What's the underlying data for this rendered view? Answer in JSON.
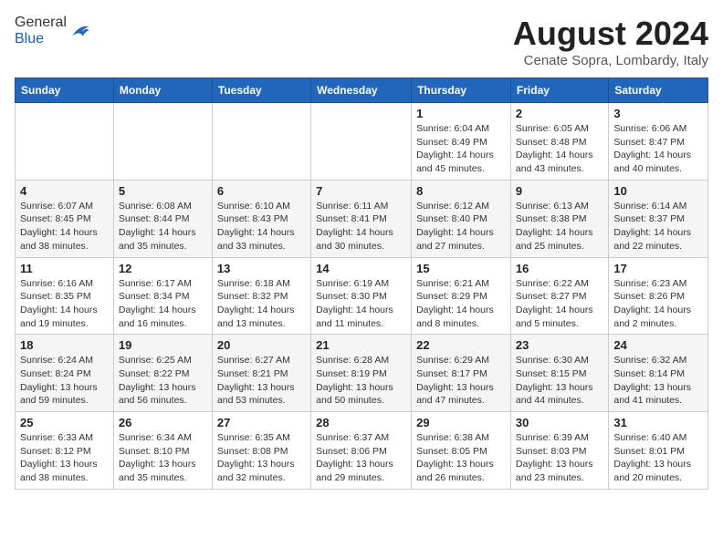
{
  "header": {
    "logo_general": "General",
    "logo_blue": "Blue",
    "month": "August 2024",
    "location": "Cenate Sopra, Lombardy, Italy"
  },
  "days_of_week": [
    "Sunday",
    "Monday",
    "Tuesday",
    "Wednesday",
    "Thursday",
    "Friday",
    "Saturday"
  ],
  "weeks": [
    [
      {
        "day": "",
        "info": ""
      },
      {
        "day": "",
        "info": ""
      },
      {
        "day": "",
        "info": ""
      },
      {
        "day": "",
        "info": ""
      },
      {
        "day": "1",
        "info": "Sunrise: 6:04 AM\nSunset: 8:49 PM\nDaylight: 14 hours\nand 45 minutes."
      },
      {
        "day": "2",
        "info": "Sunrise: 6:05 AM\nSunset: 8:48 PM\nDaylight: 14 hours\nand 43 minutes."
      },
      {
        "day": "3",
        "info": "Sunrise: 6:06 AM\nSunset: 8:47 PM\nDaylight: 14 hours\nand 40 minutes."
      }
    ],
    [
      {
        "day": "4",
        "info": "Sunrise: 6:07 AM\nSunset: 8:45 PM\nDaylight: 14 hours\nand 38 minutes."
      },
      {
        "day": "5",
        "info": "Sunrise: 6:08 AM\nSunset: 8:44 PM\nDaylight: 14 hours\nand 35 minutes."
      },
      {
        "day": "6",
        "info": "Sunrise: 6:10 AM\nSunset: 8:43 PM\nDaylight: 14 hours\nand 33 minutes."
      },
      {
        "day": "7",
        "info": "Sunrise: 6:11 AM\nSunset: 8:41 PM\nDaylight: 14 hours\nand 30 minutes."
      },
      {
        "day": "8",
        "info": "Sunrise: 6:12 AM\nSunset: 8:40 PM\nDaylight: 14 hours\nand 27 minutes."
      },
      {
        "day": "9",
        "info": "Sunrise: 6:13 AM\nSunset: 8:38 PM\nDaylight: 14 hours\nand 25 minutes."
      },
      {
        "day": "10",
        "info": "Sunrise: 6:14 AM\nSunset: 8:37 PM\nDaylight: 14 hours\nand 22 minutes."
      }
    ],
    [
      {
        "day": "11",
        "info": "Sunrise: 6:16 AM\nSunset: 8:35 PM\nDaylight: 14 hours\nand 19 minutes."
      },
      {
        "day": "12",
        "info": "Sunrise: 6:17 AM\nSunset: 8:34 PM\nDaylight: 14 hours\nand 16 minutes."
      },
      {
        "day": "13",
        "info": "Sunrise: 6:18 AM\nSunset: 8:32 PM\nDaylight: 14 hours\nand 13 minutes."
      },
      {
        "day": "14",
        "info": "Sunrise: 6:19 AM\nSunset: 8:30 PM\nDaylight: 14 hours\nand 11 minutes."
      },
      {
        "day": "15",
        "info": "Sunrise: 6:21 AM\nSunset: 8:29 PM\nDaylight: 14 hours\nand 8 minutes."
      },
      {
        "day": "16",
        "info": "Sunrise: 6:22 AM\nSunset: 8:27 PM\nDaylight: 14 hours\nand 5 minutes."
      },
      {
        "day": "17",
        "info": "Sunrise: 6:23 AM\nSunset: 8:26 PM\nDaylight: 14 hours\nand 2 minutes."
      }
    ],
    [
      {
        "day": "18",
        "info": "Sunrise: 6:24 AM\nSunset: 8:24 PM\nDaylight: 13 hours\nand 59 minutes."
      },
      {
        "day": "19",
        "info": "Sunrise: 6:25 AM\nSunset: 8:22 PM\nDaylight: 13 hours\nand 56 minutes."
      },
      {
        "day": "20",
        "info": "Sunrise: 6:27 AM\nSunset: 8:21 PM\nDaylight: 13 hours\nand 53 minutes."
      },
      {
        "day": "21",
        "info": "Sunrise: 6:28 AM\nSunset: 8:19 PM\nDaylight: 13 hours\nand 50 minutes."
      },
      {
        "day": "22",
        "info": "Sunrise: 6:29 AM\nSunset: 8:17 PM\nDaylight: 13 hours\nand 47 minutes."
      },
      {
        "day": "23",
        "info": "Sunrise: 6:30 AM\nSunset: 8:15 PM\nDaylight: 13 hours\nand 44 minutes."
      },
      {
        "day": "24",
        "info": "Sunrise: 6:32 AM\nSunset: 8:14 PM\nDaylight: 13 hours\nand 41 minutes."
      }
    ],
    [
      {
        "day": "25",
        "info": "Sunrise: 6:33 AM\nSunset: 8:12 PM\nDaylight: 13 hours\nand 38 minutes."
      },
      {
        "day": "26",
        "info": "Sunrise: 6:34 AM\nSunset: 8:10 PM\nDaylight: 13 hours\nand 35 minutes."
      },
      {
        "day": "27",
        "info": "Sunrise: 6:35 AM\nSunset: 8:08 PM\nDaylight: 13 hours\nand 32 minutes."
      },
      {
        "day": "28",
        "info": "Sunrise: 6:37 AM\nSunset: 8:06 PM\nDaylight: 13 hours\nand 29 minutes."
      },
      {
        "day": "29",
        "info": "Sunrise: 6:38 AM\nSunset: 8:05 PM\nDaylight: 13 hours\nand 26 minutes."
      },
      {
        "day": "30",
        "info": "Sunrise: 6:39 AM\nSunset: 8:03 PM\nDaylight: 13 hours\nand 23 minutes."
      },
      {
        "day": "31",
        "info": "Sunrise: 6:40 AM\nSunset: 8:01 PM\nDaylight: 13 hours\nand 20 minutes."
      }
    ]
  ]
}
